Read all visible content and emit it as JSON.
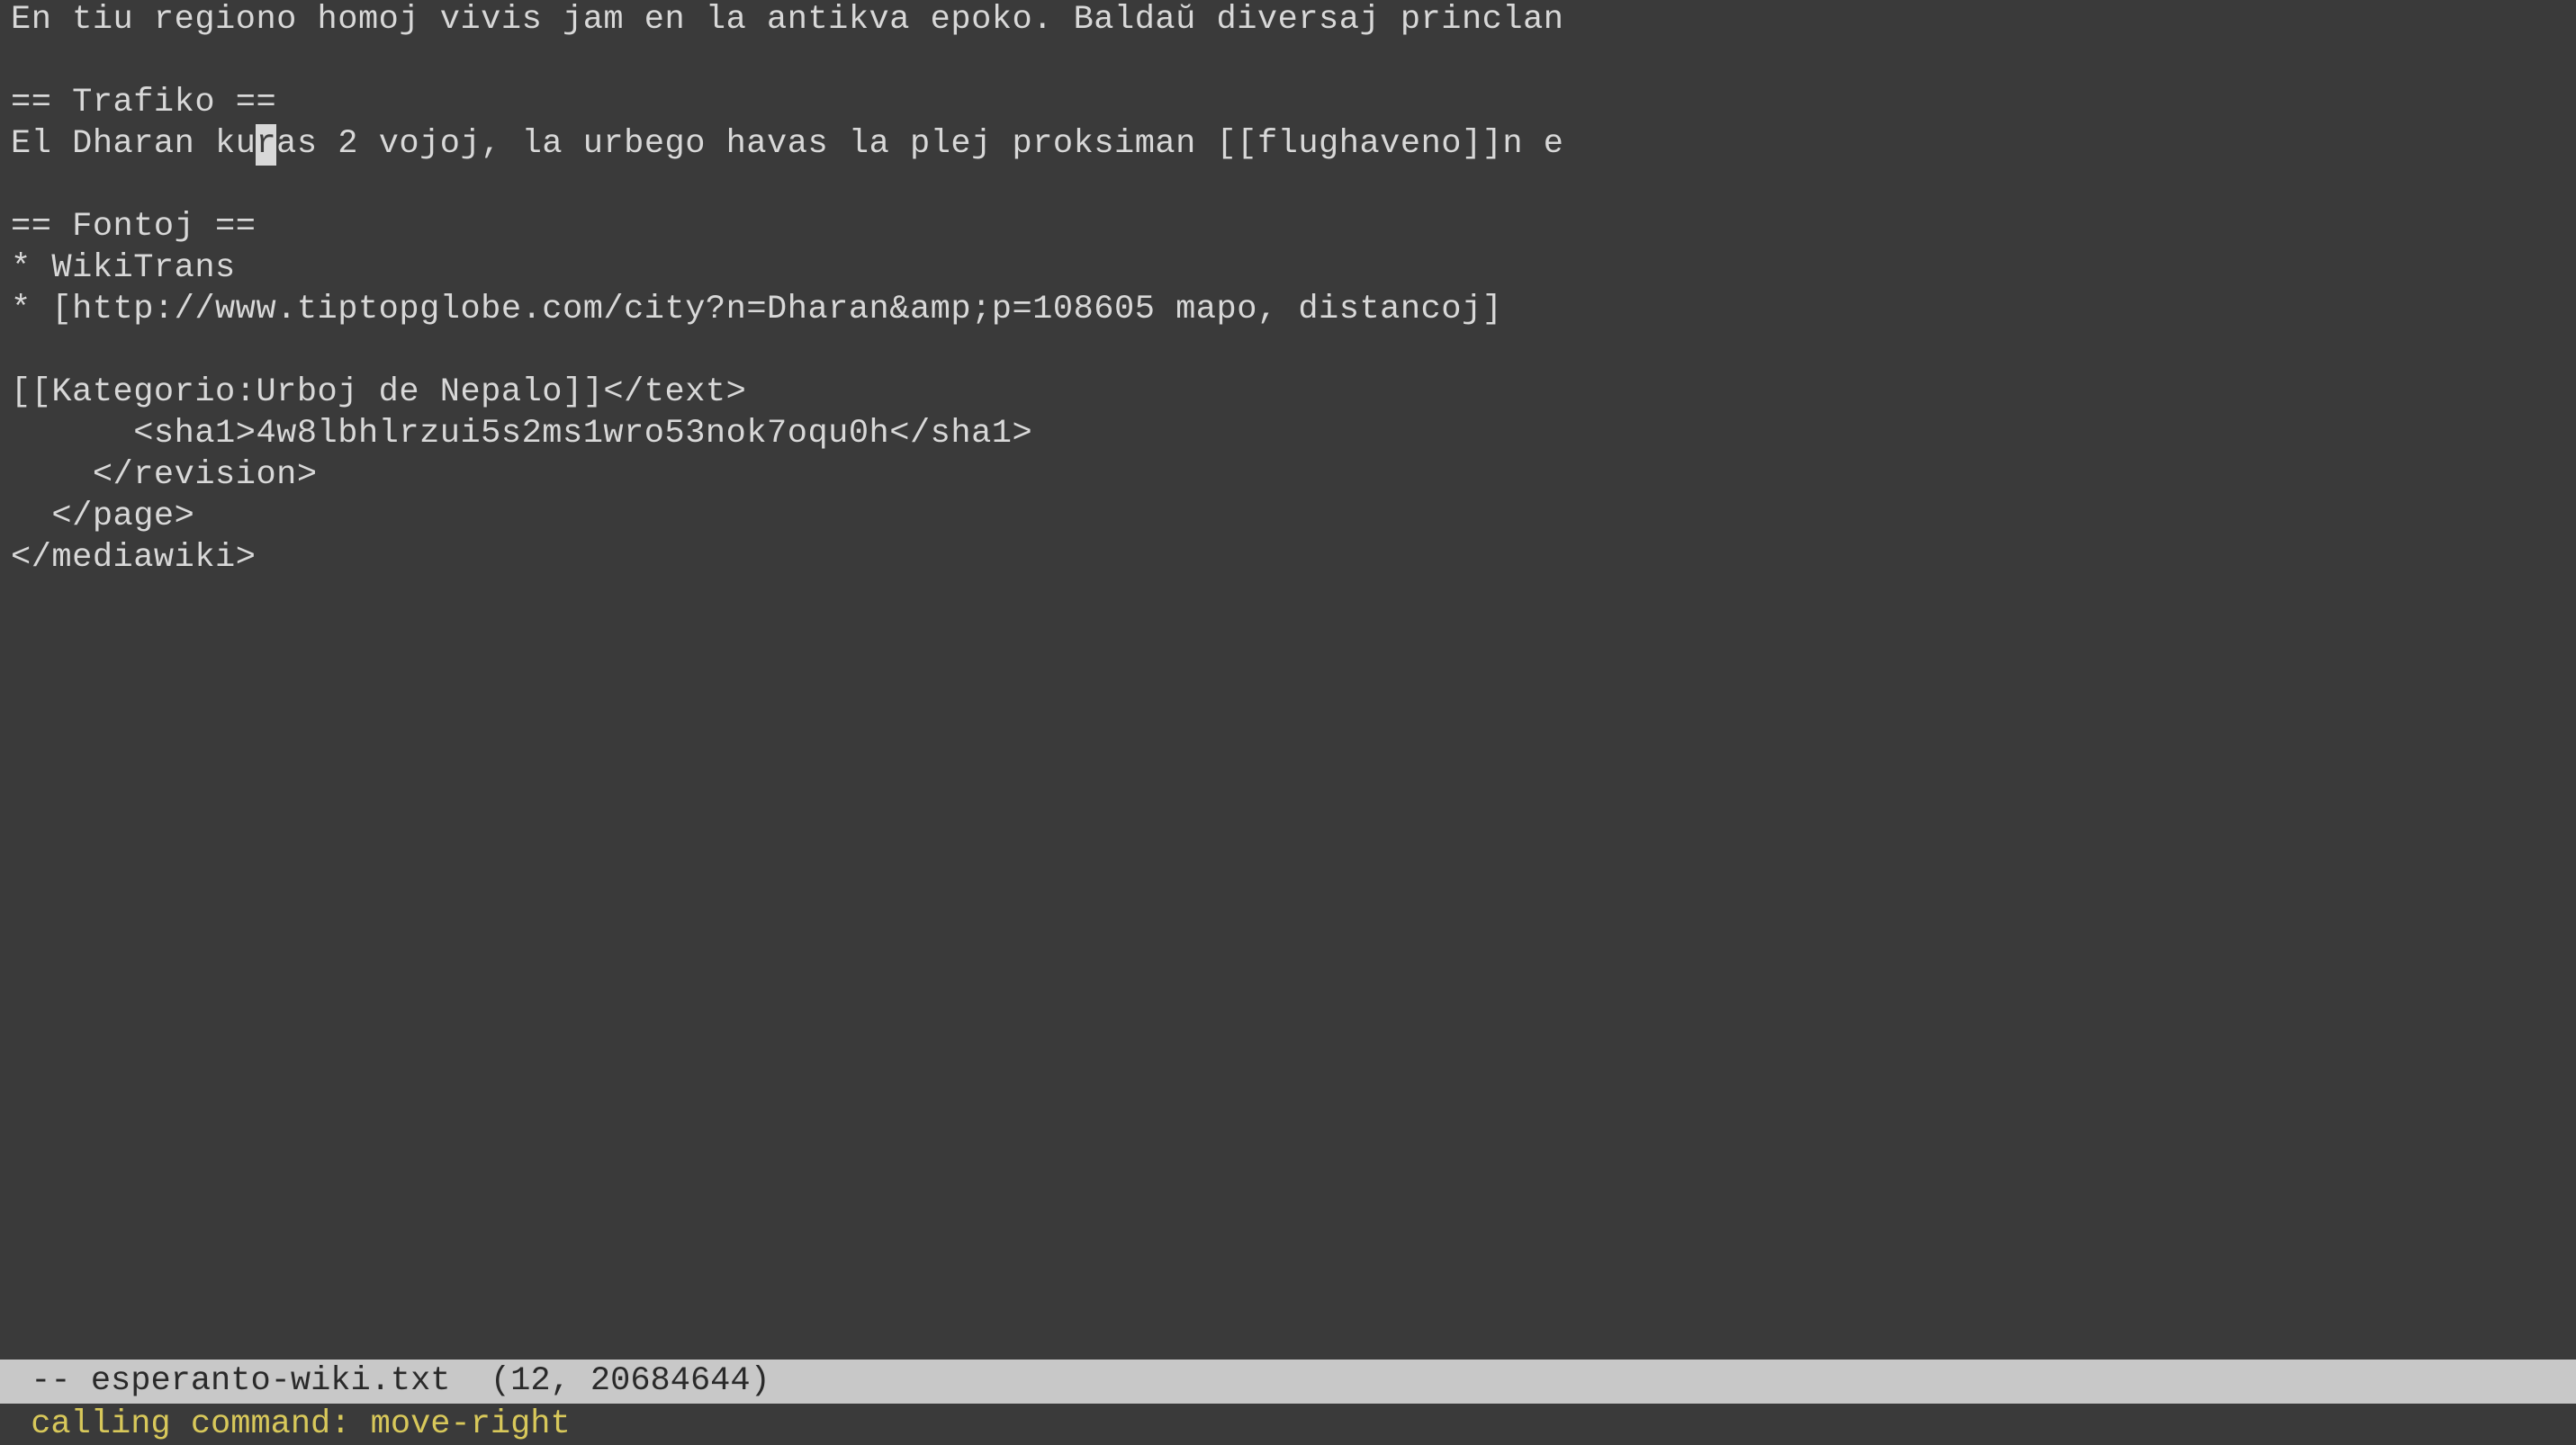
{
  "lines": [
    "En tiu regiono homoj vivis jam en la antikva epoko. Baldaŭ diversaj princlan",
    "",
    "== Trafiko ==",
    {
      "pre": "El Dharan ku",
      "cursor": "r",
      "post": "as 2 vojoj, la urbego havas la plej proksiman [[flughaveno]]n e"
    },
    "",
    "== Fontoj ==",
    "* WikiTrans",
    "* [http://www.tiptopglobe.com/city?n=Dharan&amp;p=108605 mapo, distancoj]",
    "",
    "[[Kategorio:Urboj de Nepalo]]</text>",
    "      <sha1>4w8lbhlrzui5s2ms1wro53nok7oqu0h</sha1>",
    "    </revision>",
    "  </page>",
    "</mediawiki>"
  ],
  "status": {
    "prefix": " -- ",
    "filename": "esperanto-wiki.txt",
    "position": "  (12, 20684644)"
  },
  "command": {
    "prefix": " calling command: ",
    "name": "move-right"
  }
}
